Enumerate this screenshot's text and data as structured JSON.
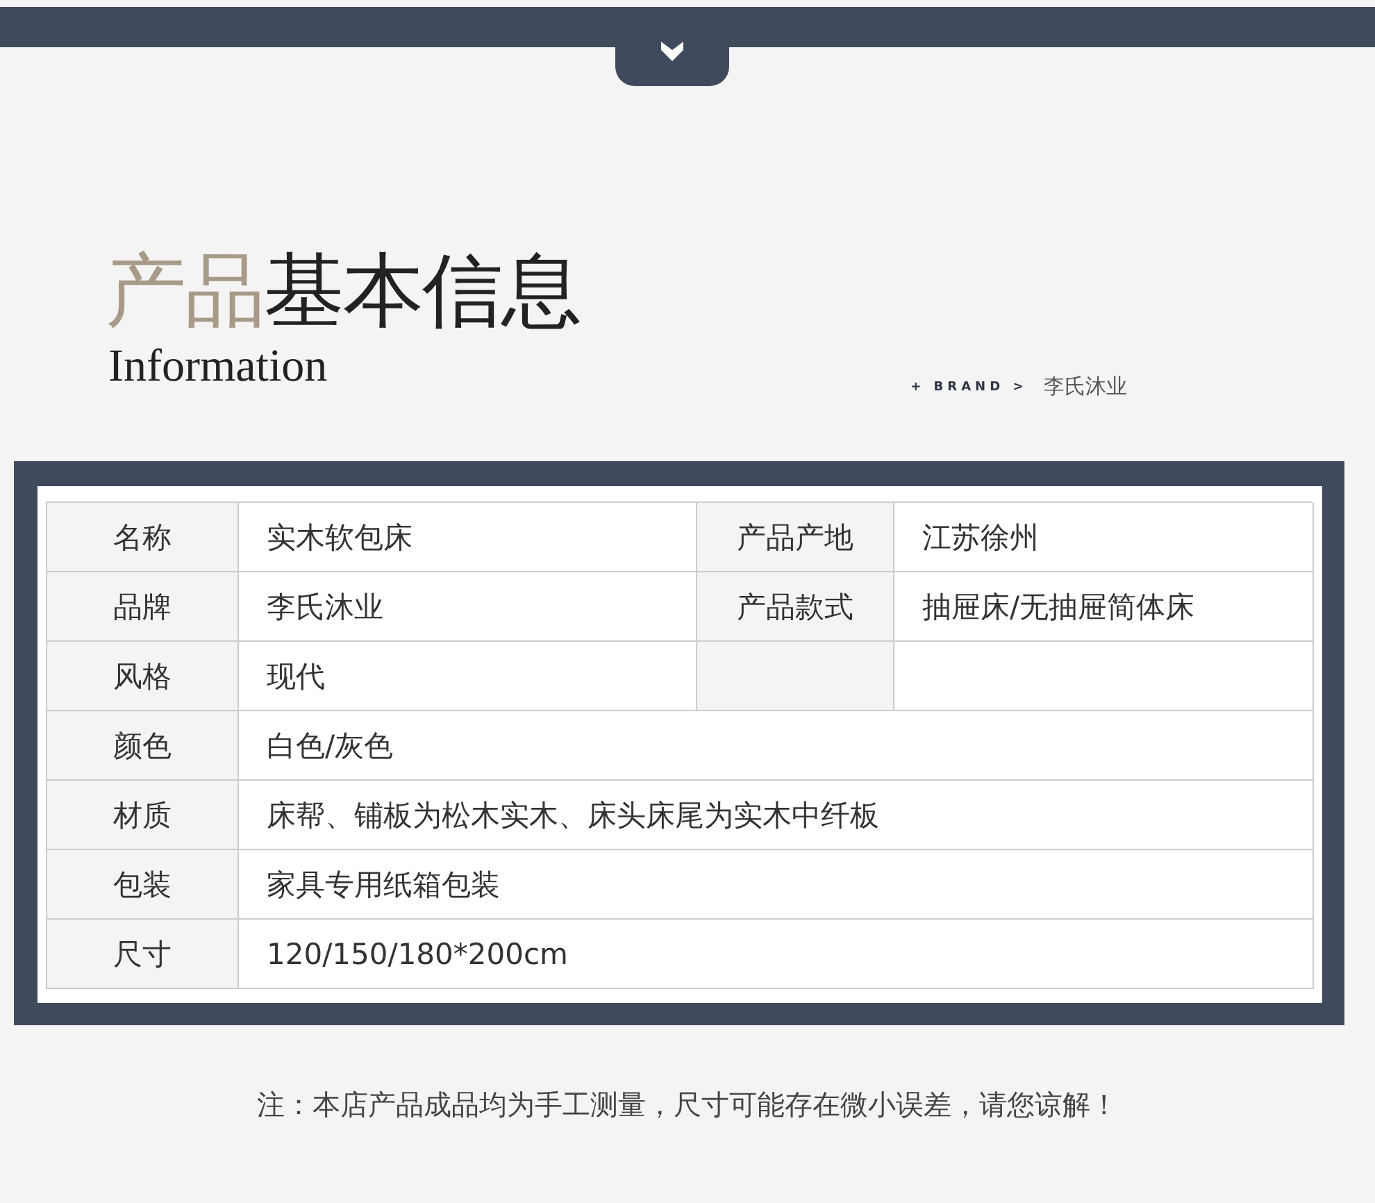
{
  "title": {
    "accent": "产品",
    "main": "基本信息"
  },
  "subtitle": "Information",
  "brand": {
    "label": "+ BRAND >",
    "value": "李氏沐业"
  },
  "table": {
    "rows": [
      {
        "cells": [
          {
            "kind": "label",
            "text": "名称"
          },
          {
            "kind": "value",
            "text": "实木软包床"
          },
          {
            "kind": "label",
            "text": "产品产地"
          },
          {
            "kind": "value",
            "text": "江苏徐州"
          }
        ]
      },
      {
        "cells": [
          {
            "kind": "label",
            "text": "品牌"
          },
          {
            "kind": "value",
            "text": "李氏沐业"
          },
          {
            "kind": "label",
            "text": "产品款式"
          },
          {
            "kind": "value",
            "text": "抽屉床/无抽屉简体床"
          }
        ]
      },
      {
        "cells": [
          {
            "kind": "label",
            "text": "风格"
          },
          {
            "kind": "value",
            "text": "现代"
          },
          {
            "kind": "blank-label"
          },
          {
            "kind": "blank-value"
          }
        ]
      },
      {
        "cells": [
          {
            "kind": "label",
            "text": "颜色"
          },
          {
            "kind": "wide",
            "text": "白色/灰色"
          }
        ]
      },
      {
        "cells": [
          {
            "kind": "label",
            "text": "材质"
          },
          {
            "kind": "wide",
            "text": "床帮、铺板为松木实木、床头床尾为实木中纤板"
          }
        ]
      },
      {
        "cells": [
          {
            "kind": "label",
            "text": "包装"
          },
          {
            "kind": "wide",
            "text": "家具专用纸箱包装"
          }
        ]
      },
      {
        "cells": [
          {
            "kind": "label",
            "text": "尺寸"
          },
          {
            "kind": "wide",
            "text": "120/150/180*200cm"
          }
        ]
      }
    ]
  },
  "note": "注：本店产品成品均为手工测量，尺寸可能存在微小误差，请您谅解！"
}
